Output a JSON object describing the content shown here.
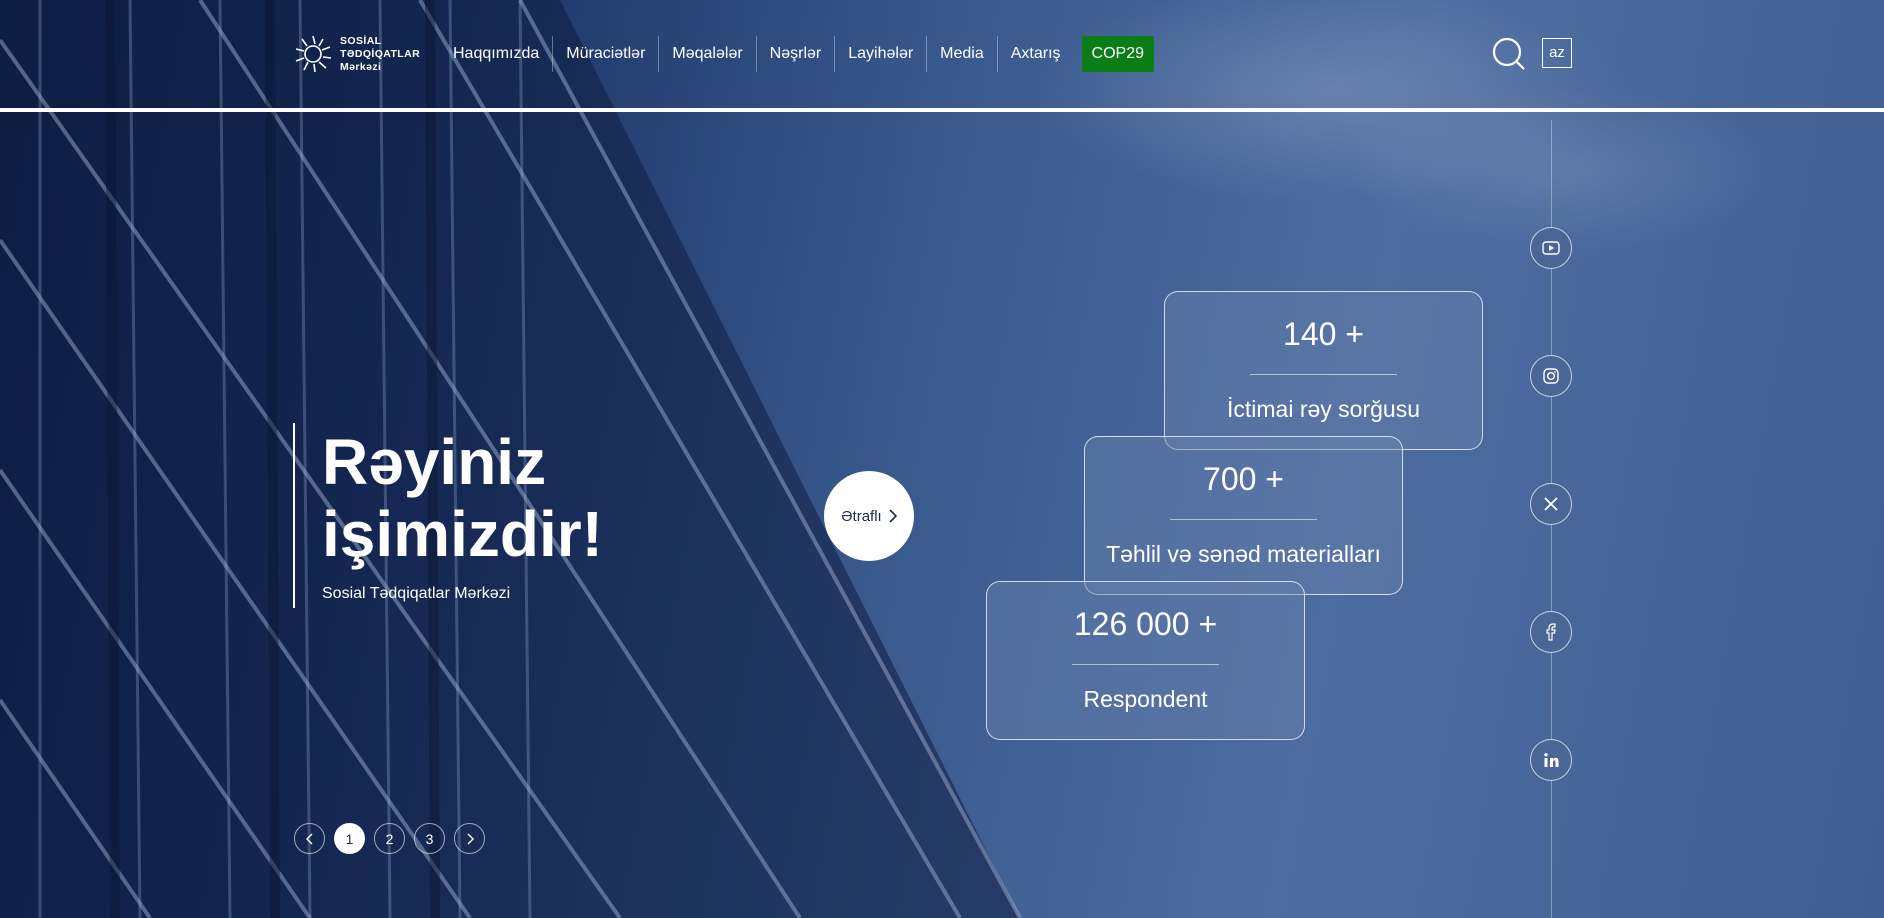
{
  "logo": {
    "line1": "SOSİAL",
    "line2": "TƏDQİQATLAR",
    "line3": "Mərkəzi"
  },
  "nav": {
    "items": [
      "Haqqımızda",
      "Müraciətlər",
      "Məqalələr",
      "Nəşrlər",
      "Layihələr",
      "Media",
      "Axtarış",
      "COP29"
    ]
  },
  "header": {
    "search_icon": "search-icon",
    "lang": "az"
  },
  "colors": {
    "cop_badge": "#0a7d17",
    "accent": "#ffffff"
  },
  "social": {
    "icons": [
      "youtube-icon",
      "instagram-icon",
      "x-icon",
      "facebook-icon",
      "linkedin-icon"
    ]
  },
  "hero": {
    "title_line1": "Rəyiniz",
    "title_line2": "işimizdir!",
    "subtitle": "Sosial Tədqiqatlar Mərkəzi",
    "more_label": "Ətraflı"
  },
  "stats": [
    {
      "value": "140 +",
      "label": "İctimai rəy sorğusu"
    },
    {
      "value": "700 +",
      "label": "Təhlil və sənəd materialları"
    },
    {
      "value": "126 000 +",
      "label": "Respondent"
    }
  ],
  "pager": {
    "pages": [
      "1",
      "2",
      "3"
    ],
    "active": "1"
  }
}
